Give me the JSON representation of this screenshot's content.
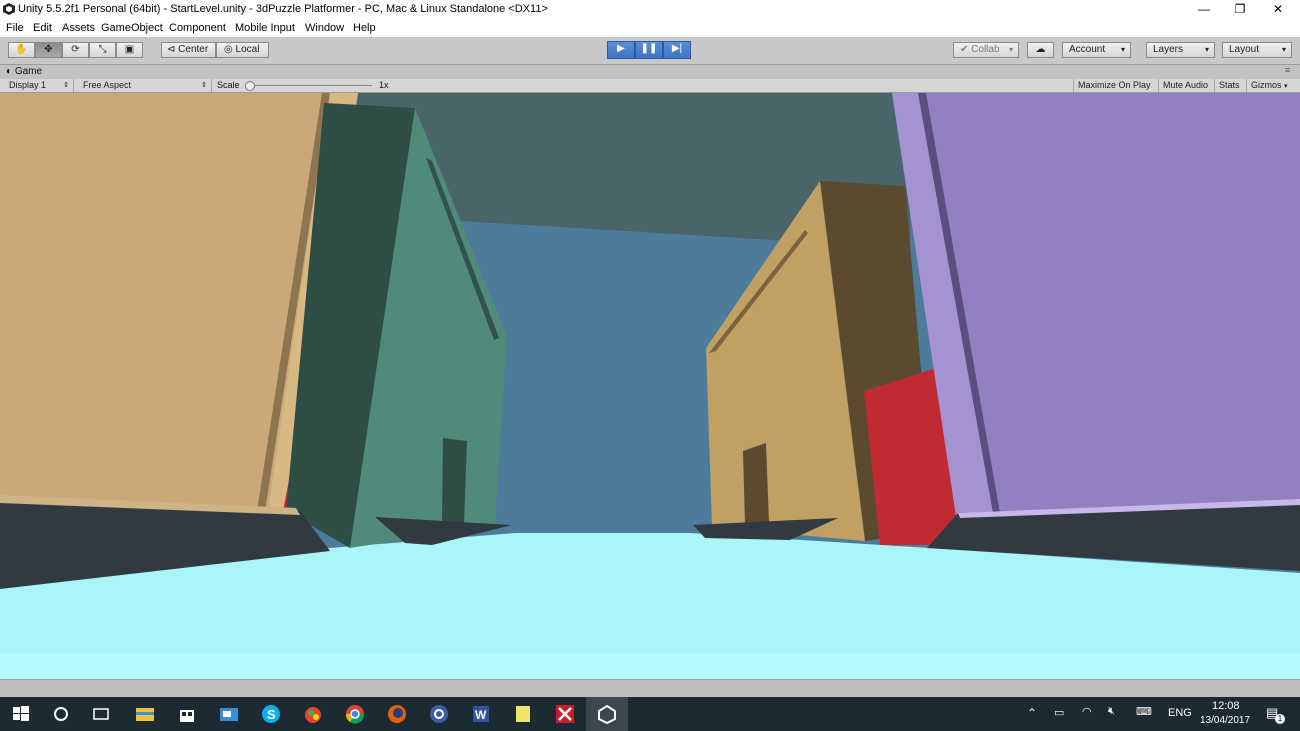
{
  "window": {
    "title": "Unity 5.5.2f1 Personal (64bit) - StartLevel.unity - 3dPuzzle Platformer - PC, Mac & Linux Standalone <DX11>",
    "minimize_glyph": "—",
    "maximize_glyph": "❐",
    "close_glyph": "✕"
  },
  "menu": {
    "items": [
      "File",
      "Edit",
      "Assets",
      "GameObject",
      "Component",
      "Mobile Input",
      "Window",
      "Help"
    ]
  },
  "toolbar": {
    "tools": [
      {
        "icon": "hand-icon",
        "glyph": "✋"
      },
      {
        "icon": "move-icon",
        "glyph": "✥"
      },
      {
        "icon": "rotate-icon",
        "glyph": "⟳"
      },
      {
        "icon": "scale-icon",
        "glyph": "⤡"
      },
      {
        "icon": "rect-tool-icon",
        "glyph": "▣"
      }
    ],
    "pivot_label": "Center",
    "pivot_icon": "⊲",
    "space_label": "Local",
    "space_icon": "◎",
    "play_glyph": "▶",
    "pause_glyph": "❚❚",
    "step_glyph": "▶|",
    "collab_label": "Collab",
    "collab_icon": "✔",
    "cloud_glyph": "☁",
    "account_label": "Account",
    "layers_label": "Layers",
    "layout_label": "Layout",
    "dropdown_glyph": "▾"
  },
  "game_view": {
    "tab_label": "Game",
    "tab_icon": "◐",
    "display_label": "Display 1",
    "aspect_label": "Free Aspect",
    "scale_label": "Scale",
    "scale_value": "1x",
    "buttons": [
      "Maximize On Play",
      "Mute Audio",
      "Stats",
      "Gizmos"
    ],
    "colors": {
      "sky_top": "#4a6569",
      "sky_center": "#4d7b9b",
      "floor": "#aaf5f7",
      "tan_wall": "#cba877",
      "teal_block": "#4f8a7a",
      "khaki_block": "#c0a063",
      "purple_wall": "#9280c0",
      "red_accent": "#c22a33"
    }
  },
  "taskbar": {
    "apps": [
      "windows-start-icon",
      "cortana-search-icon",
      "task-view-icon",
      "file-explorer-icon",
      "store-icon",
      "mail-icon",
      "skype-icon",
      "paint-app-icon",
      "chrome-icon",
      "firefox-icon",
      "settings-app-icon",
      "word-icon",
      "sticky-notes-icon",
      "game-app-icon",
      "unity-icon"
    ],
    "language": "ENG",
    "time": "12:08",
    "date": "13/04/2017",
    "notification_count": "1"
  }
}
